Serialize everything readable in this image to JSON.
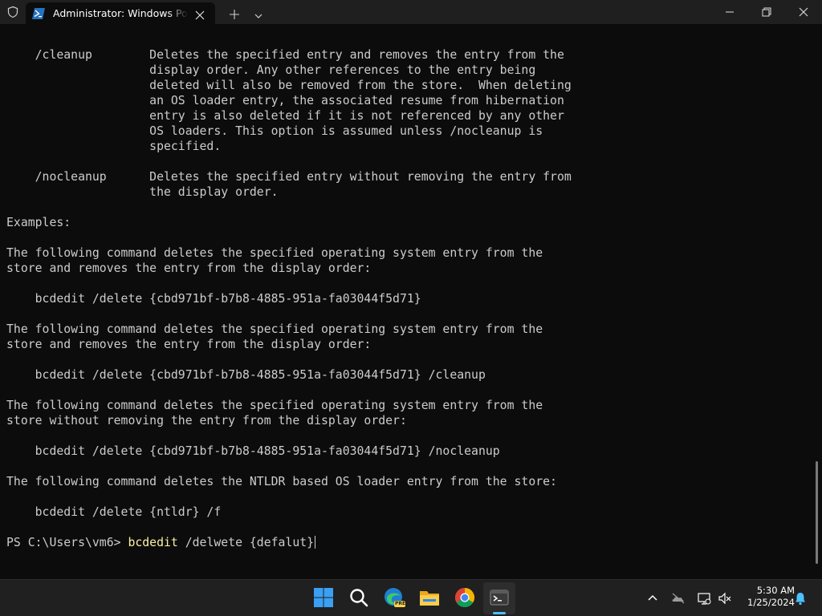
{
  "window": {
    "tab_title": "Administrator: Windows PowerShell"
  },
  "terminal": {
    "lines": [
      {
        "text": "    /cleanup        Deletes the specified entry and removes the entry from the"
      },
      {
        "text": "                    display order. Any other references to the entry being"
      },
      {
        "text": "                    deleted will also be removed from the store.  When deleting"
      },
      {
        "text": "                    an OS loader entry, the associated resume from hibernation"
      },
      {
        "text": "                    entry is also deleted if it is not referenced by any other"
      },
      {
        "text": "                    OS loaders. This option is assumed unless /nocleanup is"
      },
      {
        "text": "                    specified."
      },
      {
        "text": ""
      },
      {
        "text": "    /nocleanup      Deletes the specified entry without removing the entry from"
      },
      {
        "text": "                    the display order."
      },
      {
        "text": ""
      },
      {
        "text": "Examples:"
      },
      {
        "text": ""
      },
      {
        "text": "The following command deletes the specified operating system entry from the"
      },
      {
        "text": "store and removes the entry from the display order:"
      },
      {
        "text": ""
      },
      {
        "text": "    bcdedit /delete {cbd971bf-b7b8-4885-951a-fa03044f5d71}"
      },
      {
        "text": ""
      },
      {
        "text": "The following command deletes the specified operating system entry from the"
      },
      {
        "text": "store and removes the entry from the display order:"
      },
      {
        "text": ""
      },
      {
        "text": "    bcdedit /delete {cbd971bf-b7b8-4885-951a-fa03044f5d71} /cleanup"
      },
      {
        "text": ""
      },
      {
        "text": "The following command deletes the specified operating system entry from the"
      },
      {
        "text": "store without removing the entry from the display order:"
      },
      {
        "text": ""
      },
      {
        "text": "    bcdedit /delete {cbd971bf-b7b8-4885-951a-fa03044f5d71} /nocleanup"
      },
      {
        "text": ""
      },
      {
        "text": "The following command deletes the NTLDR based OS loader entry from the store:"
      },
      {
        "text": ""
      },
      {
        "text": "    bcdedit /delete {ntldr} /f"
      },
      {
        "text": ""
      }
    ],
    "prompt": {
      "path": "PS C:\\Users\\vm6> ",
      "command": "bcdedit",
      "args": " /delwete {defalut}"
    }
  },
  "taskbar": {
    "apps": [
      "start-icon",
      "search-icon",
      "edge-icon",
      "file-explorer-icon",
      "chrome-icon",
      "terminal-icon"
    ],
    "edge_badge": "PRE",
    "time": "5:30 AM",
    "date": "1/25/2024"
  },
  "colors": {
    "terminal_bg": "#0c0c0c",
    "text": "#cccccc",
    "command": "#f9f1a5",
    "accent": "#4cc2ff"
  }
}
